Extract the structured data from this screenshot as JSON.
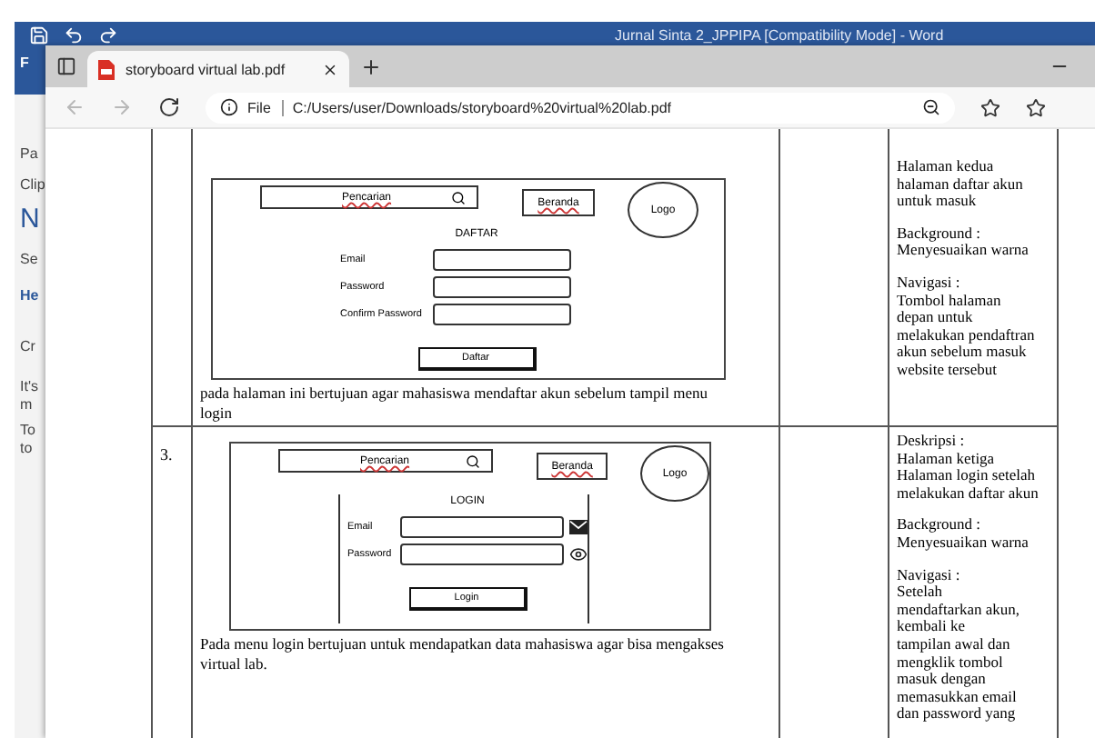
{
  "word_window": {
    "title": "Jurnal Sinta 2_JPPIPA [Compatibility Mode]  -  Word",
    "side_fragments": [
      "F",
      "Pa",
      "Clip",
      "N",
      "Se",
      "He",
      "Cr",
      "It's",
      "m",
      "To",
      "to"
    ]
  },
  "browser": {
    "tabs": [
      {
        "title": "storyboard virtual lab.pdf",
        "selected": true
      }
    ],
    "address": {
      "scheme": "File",
      "url": "C:/Users/user/Downloads/storyboard%20virtual%20lab.pdf"
    }
  },
  "table": {
    "rows": [
      {
        "mockup": {
          "kind": "register",
          "search": "Pencarian",
          "home": "Beranda",
          "logo": "Logo",
          "heading": "DAFTAR",
          "fields": [
            {
              "label": "Email"
            },
            {
              "label": "Password"
            },
            {
              "label": "Confirm Password"
            }
          ],
          "button": "Daftar"
        },
        "caption": "pada halaman ini bertujuan agar mahasiswa mendaftar akun sebelum tampil menu login",
        "description": [
          [
            "Halaman kedua",
            "halaman daftar akun",
            "untuk masuk"
          ],
          [
            "Background :",
            "Menyesuaikan warna"
          ],
          [
            "Navigasi :",
            "Tombol halaman",
            "depan untuk",
            "melakukan pendaftran",
            "akun sebelum masuk",
            "website tersebut"
          ]
        ]
      },
      {
        "number": "3.",
        "mockup": {
          "kind": "login",
          "search": "Pencarian",
          "home": "Beranda",
          "logo": "Logo",
          "heading": "LOGIN",
          "fields": [
            {
              "label": "Email"
            },
            {
              "label": "Password"
            }
          ],
          "button": "Login"
        },
        "caption": "Pada menu login bertujuan untuk mendapatkan data mahasiswa agar bisa mengakses virtual lab.",
        "description": [
          [
            "Deskripsi :",
            "Halaman ketiga",
            "Halaman login setelah",
            "melakukan daftar akun"
          ],
          [
            "Background :",
            "Menyesuaikan warna"
          ],
          [
            "Navigasi :",
            "Setelah",
            "mendaftarkan akun,",
            "kembali ke",
            "tampilan awal dan",
            "mengklik tombol",
            "masuk dengan",
            "memasukkan email",
            "dan password yang"
          ]
        ]
      }
    ]
  }
}
